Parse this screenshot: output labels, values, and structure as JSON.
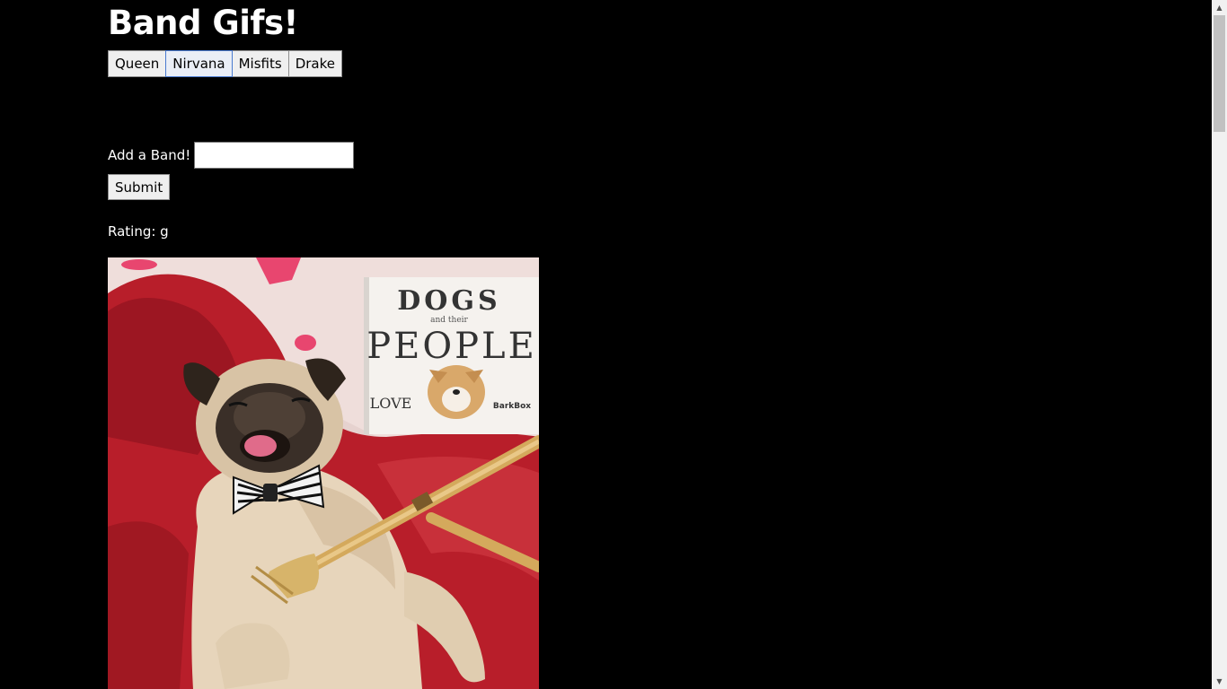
{
  "header": {
    "title": "Band Gifs!"
  },
  "bands": [
    {
      "label": "Queen"
    },
    {
      "label": "Nirvana"
    },
    {
      "label": "Misfits"
    },
    {
      "label": "Drake"
    }
  ],
  "form": {
    "label": "Add a Band!",
    "input_value": "",
    "submit_label": "Submit"
  },
  "results": [
    {
      "rating_label": "Rating: g",
      "image": {
        "book_title_line1": "DOGS",
        "book_title_small": "and their",
        "book_title_line2": "PEOPLE",
        "book_title_line3": "LOVE",
        "book_brand": "BarkBox"
      }
    }
  ],
  "scrollbar": {
    "up_icon": "▲",
    "down_icon": "▼"
  },
  "colors": {
    "background": "#000000",
    "text": "#ffffff",
    "button_bg": "#efefef",
    "active_border": "#4a7bd0"
  }
}
